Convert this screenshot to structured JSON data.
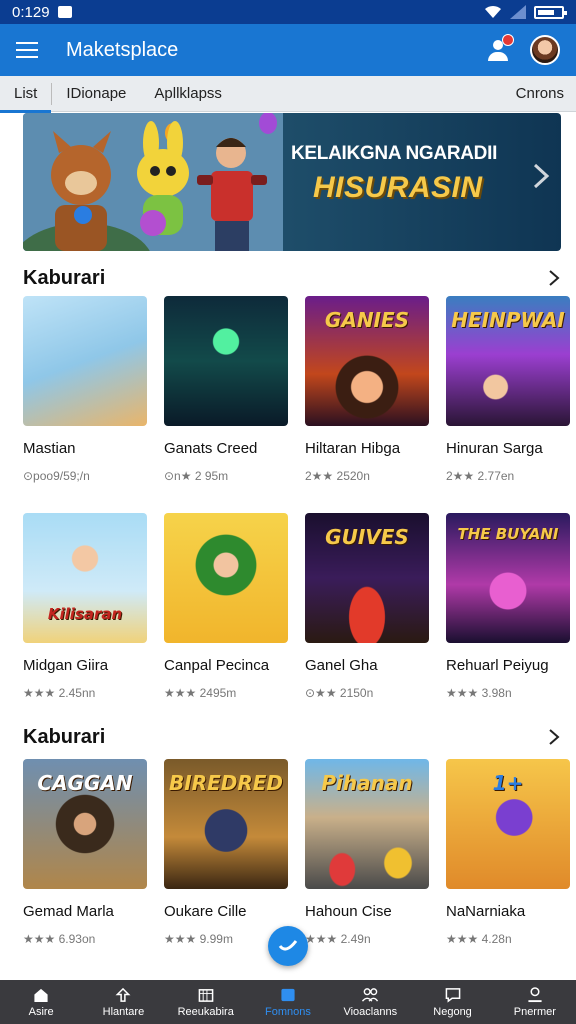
{
  "status_bar": {
    "time": "0:129"
  },
  "app_bar": {
    "title": "Maketsplace"
  },
  "tabs": [
    {
      "label": "List",
      "active": true
    },
    {
      "label": "IDionape",
      "active": false
    },
    {
      "label": "Apllklapss",
      "active": false
    }
  ],
  "tab_right": "Cnrons",
  "banner": {
    "line1": "KELAIKGNA NGARADII",
    "line2": "HISURASIN"
  },
  "sections": [
    {
      "title": "Kaburari",
      "cards": [
        {
          "title": "Mastian",
          "meta": "⊙poo9/59;/n",
          "thumb": "blue"
        },
        {
          "title": "Ganats Creed",
          "meta": "⊙n★ 2 95m",
          "thumb": "neon"
        },
        {
          "title": "Hiltaran Hibga",
          "meta": "2★★ 2520n",
          "thumb": "stage"
        },
        {
          "title": "Hinuran Sarga",
          "meta": "2★★ 2.77en",
          "thumb": "party"
        },
        {
          "title": "Midgan Giira",
          "meta": "★★★ 2.45nn",
          "thumb": "sky"
        },
        {
          "title": "Canpal Pecinca",
          "meta": "★★★ 2495m",
          "thumb": "yellow"
        },
        {
          "title": "Ganel Gha",
          "meta": "⊙★★ 2150n",
          "thumb": "arena"
        },
        {
          "title": "Rehuarl Peiyug",
          "meta": "★★★ 3.98n",
          "thumb": "dance"
        }
      ]
    },
    {
      "title": "Kaburari",
      "cards": [
        {
          "title": "Gemad Marla",
          "meta": "★★★ 6.93on",
          "thumb": "action"
        },
        {
          "title": "Oukare Cille",
          "meta": "★★★ 9.99m",
          "thumb": "castle"
        },
        {
          "title": "Hahoun Cise",
          "meta": "★★★ 2.49n",
          "thumb": "race"
        },
        {
          "title": "NaNarniaka",
          "meta": "★★★ 4.28n",
          "thumb": "hero"
        }
      ]
    }
  ],
  "thumb_labels": {
    "stage": "GANIES",
    "party": "HEINPWAI",
    "sky": "Kilisaran",
    "arena": "GUIVES",
    "dance": "THE BUYANI",
    "action": "CAGGAN",
    "castle": "BIREDRED",
    "race": "Pihanan",
    "hero": "1+"
  },
  "bottom_nav": [
    {
      "label": "Asire",
      "icon": "home-icon",
      "active": false
    },
    {
      "label": "Hlantare",
      "icon": "upload-icon",
      "active": false
    },
    {
      "label": "Reeukabira",
      "icon": "calendar-icon",
      "active": false
    },
    {
      "label": "Fomnons",
      "icon": "card-icon",
      "active": true
    },
    {
      "label": "Vioaclanns",
      "icon": "people-icon",
      "active": false
    },
    {
      "label": "Negong",
      "icon": "chat-icon",
      "active": false
    },
    {
      "label": "Pnermer",
      "icon": "profile-icon",
      "active": false
    }
  ],
  "colors": {
    "primary": "#1976d2",
    "status_bar": "#0b3d91",
    "nav_bg": "#3a3a3e",
    "nav_active": "#2f8ef0"
  }
}
